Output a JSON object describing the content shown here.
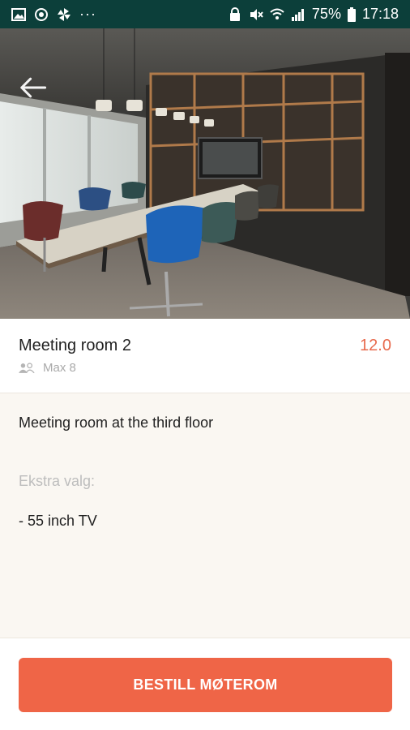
{
  "status_bar": {
    "battery": "75%",
    "time": "17:18",
    "left_icons": [
      "gallery-icon",
      "sync-icon",
      "pinwheel-icon",
      "more-dots-icon"
    ],
    "right_icons": [
      "lock-icon",
      "mute-icon",
      "wifi-icon",
      "signal-icon",
      "battery-icon"
    ],
    "more": "···"
  },
  "header": {
    "back_icon": "arrow-left-icon"
  },
  "room": {
    "title": "Meeting room 2",
    "price": "12.0",
    "capacity": "Max 8",
    "capacity_icon": "people-icon"
  },
  "details": {
    "description": "Meeting room at the third floor",
    "extra_heading": "Ekstra valg:",
    "extra_items": [
      "- 55 inch TV"
    ]
  },
  "actions": {
    "book_label": "BESTILL MØTEROM"
  },
  "colors": {
    "status_bar": "#0c3f3a",
    "accent": "#ef6547",
    "price": "#e86a4d",
    "background": "#faf7f2"
  }
}
